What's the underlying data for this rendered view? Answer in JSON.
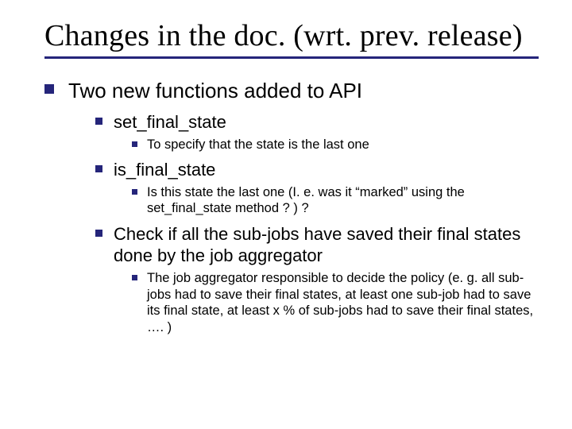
{
  "title": "Changes in the doc. (wrt. prev. release)",
  "b1": {
    "text": "Two new functions added to API",
    "children": [
      {
        "text": "set_final_state",
        "children": [
          {
            "text": "To specify that the state is the last one"
          }
        ]
      },
      {
        "text": "is_final_state",
        "children": [
          {
            "text": "Is this state the last one (I. e. was it “marked” using the set_final_state method ? ) ?"
          }
        ]
      },
      {
        "text": "Check if all the sub-jobs have saved their final states done by the job aggregator",
        "children": [
          {
            "text": "The job aggregator responsible to decide the policy (e. g. all sub-jobs had to save their final states, at least one sub-job had to save its final state, at least x % of sub-jobs had to save their final states, …. )"
          }
        ]
      }
    ]
  }
}
